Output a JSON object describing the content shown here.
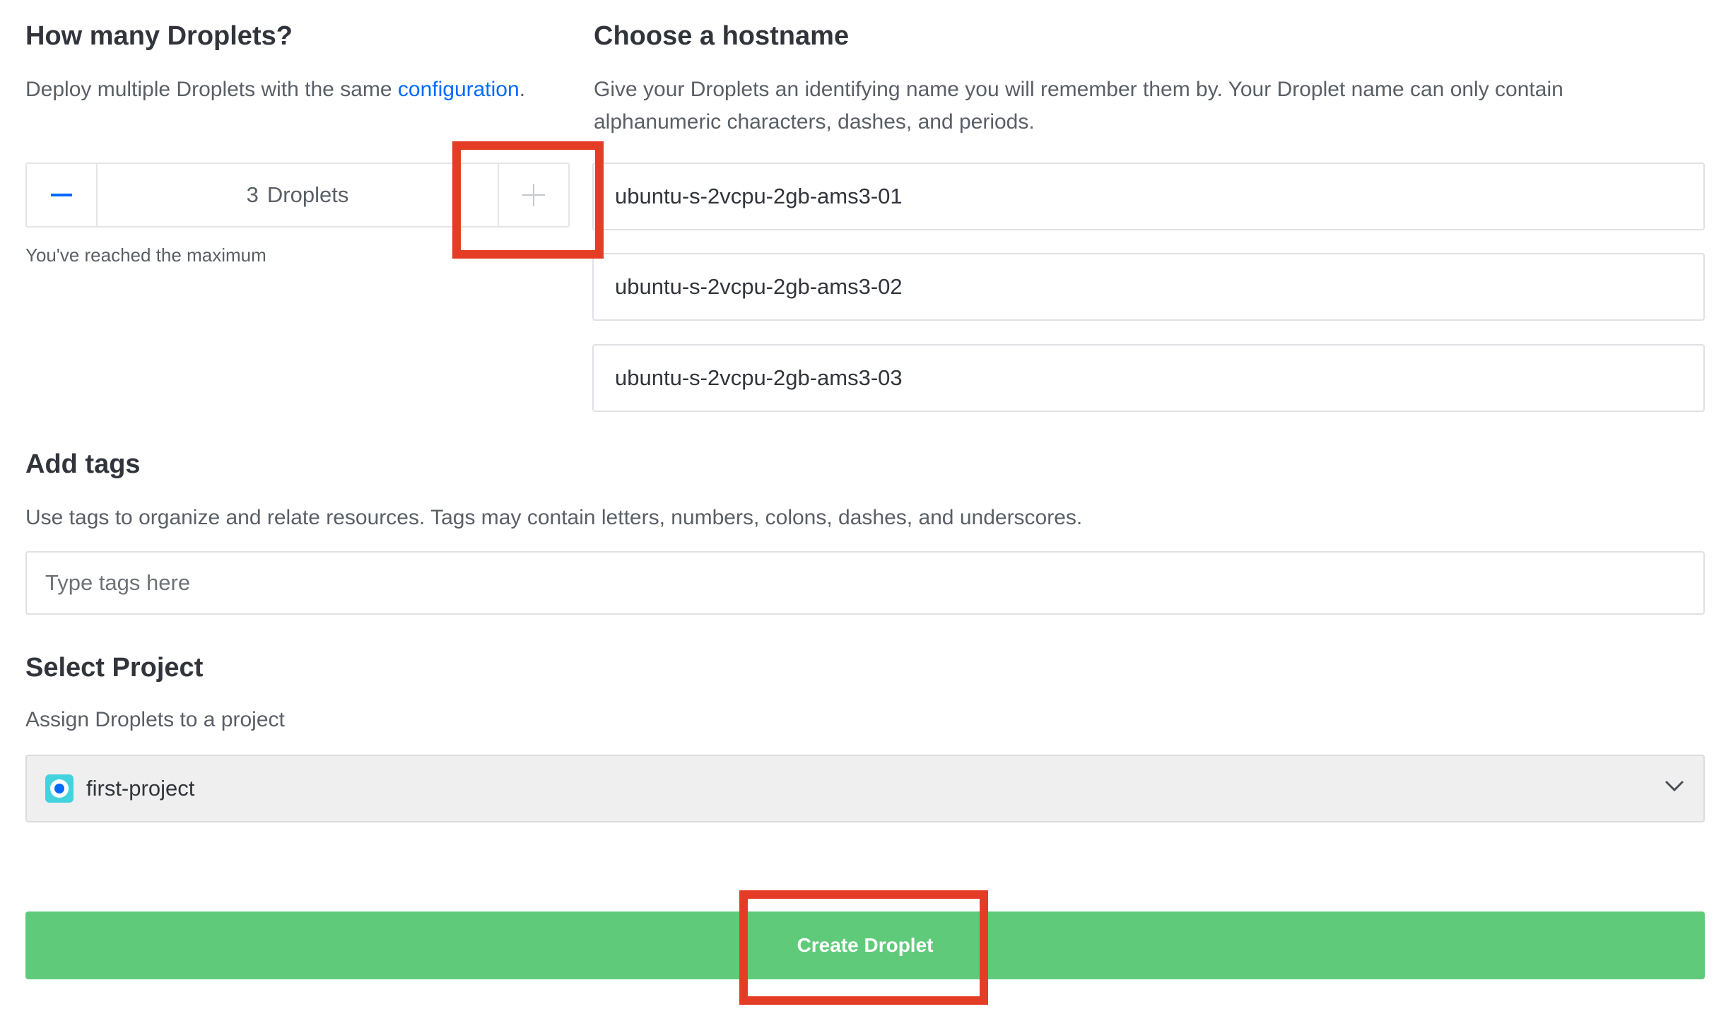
{
  "droplets": {
    "title": "How many Droplets?",
    "desc_prefix": "Deploy multiple Droplets with the same ",
    "desc_link": "configuration",
    "desc_suffix": ".",
    "count": "3",
    "unit": "Droplets",
    "hint": "You've reached the maximum"
  },
  "hostname": {
    "title": "Choose a hostname",
    "desc_line1": "Give your Droplets an identifying name you will remember them by. Your Droplet name can only contain",
    "desc_line2": "alphanumeric characters, dashes, and periods.",
    "values": [
      "ubuntu-s-2vcpu-2gb-ams3-01",
      "ubuntu-s-2vcpu-2gb-ams3-02",
      "ubuntu-s-2vcpu-2gb-ams3-03"
    ]
  },
  "tags": {
    "title": "Add tags",
    "desc": "Use tags to organize and relate resources. Tags may contain letters, numbers, colons, dashes, and underscores.",
    "placeholder": "Type tags here"
  },
  "project": {
    "title": "Select Project",
    "desc": "Assign Droplets to a project",
    "selected": "first-project"
  },
  "actions": {
    "create_label": "Create Droplet"
  },
  "colors": {
    "accent_blue": "#0069ff",
    "create_green": "#5fcb7a",
    "highlight_red": "#e53d25"
  }
}
